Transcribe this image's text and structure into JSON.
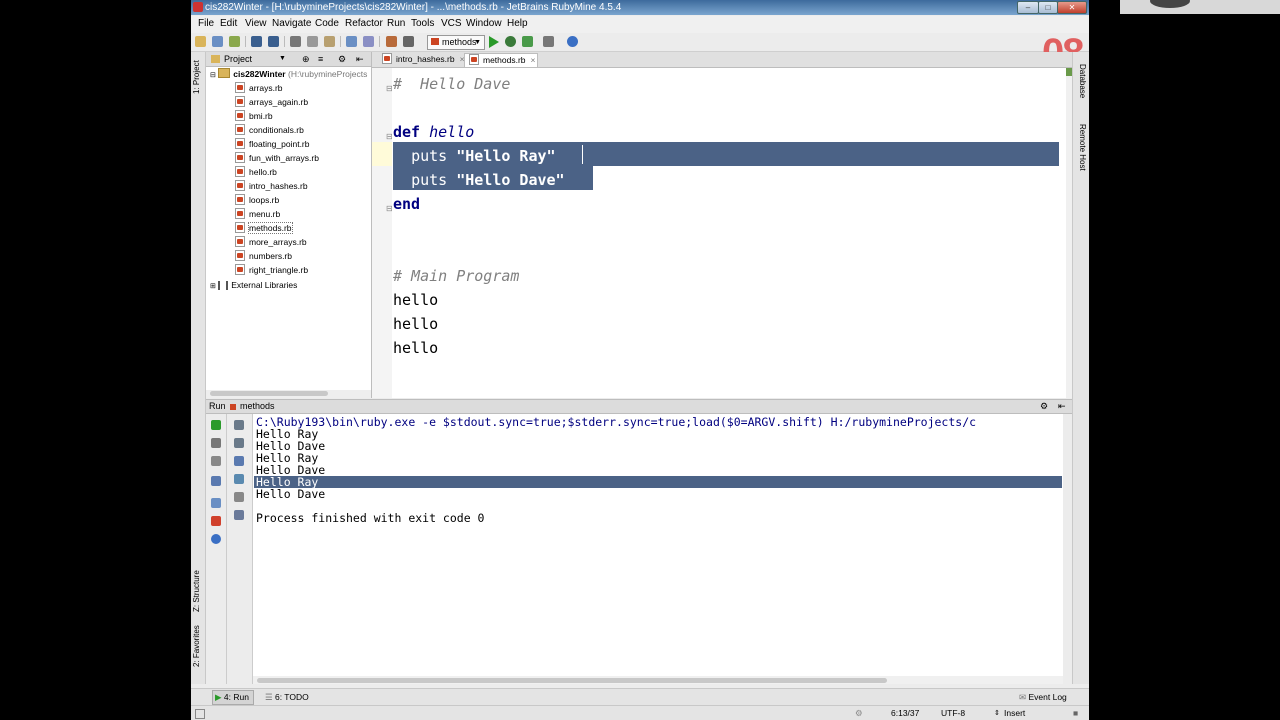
{
  "window": {
    "title": "cis282Winter - [H:\\rubymineProjects\\cis282Winter] - ...\\methods.rb - JetBrains RubyMine 4.5.4"
  },
  "menu": [
    "File",
    "Edit",
    "View",
    "Navigate",
    "Code",
    "Refactor",
    "Run",
    "Tools",
    "VCS",
    "Window",
    "Help"
  ],
  "toolbar": {
    "run_config": "methods"
  },
  "overlay_badge": "08",
  "left_strip": {
    "project": "1: Project",
    "structure": "Z: Structure",
    "favorites": "2: Favorites"
  },
  "right_strip": {
    "database": "Database",
    "remote_host": "Remote Host"
  },
  "project_panel": {
    "header": "Project",
    "root": "cis282Winter",
    "root_path": "(H:\\rubymineProjects",
    "files": [
      "arrays.rb",
      "arrays_again.rb",
      "bmi.rb",
      "conditionals.rb",
      "floating_point.rb",
      "fun_with_arrays.rb",
      "hello.rb",
      "intro_hashes.rb",
      "loops.rb",
      "menu.rb",
      "methods.rb",
      "more_arrays.rb",
      "numbers.rb",
      "right_triangle.rb"
    ],
    "external": "External Libraries"
  },
  "tabs": [
    {
      "label": "intro_hashes.rb",
      "active": false
    },
    {
      "label": "methods.rb",
      "active": true
    }
  ],
  "editor": {
    "lines": {
      "comment1": "#  Hello Dave",
      "def_kw": "def",
      "def_name": "hello",
      "puts1": "puts",
      "str1": "\"Hello Ray\"",
      "puts2": "puts",
      "str2": "\"Hello Dave\"",
      "end_kw": "end",
      "comment2": "# Main Program",
      "call1": "hello",
      "call2": "hello",
      "call3": "hello"
    }
  },
  "run_panel": {
    "label": "Run",
    "config": "methods",
    "command": "C:\\Ruby193\\bin\\ruby.exe -e $stdout.sync=true;$stderr.sync=true;load($0=ARGV.shift) H:/rubymineProjects/c",
    "output": [
      "Hello Ray",
      "Hello Dave",
      "Hello Ray",
      "Hello Dave",
      "Hello Ray",
      "Hello Dave"
    ],
    "exit": "Process finished with exit code 0"
  },
  "bottom_tabs": {
    "run": "4: Run",
    "todo": "6: TODO",
    "event_log": "Event Log"
  },
  "status": {
    "position": "6:13/37",
    "encoding": "UTF-8",
    "mode": "Insert"
  }
}
